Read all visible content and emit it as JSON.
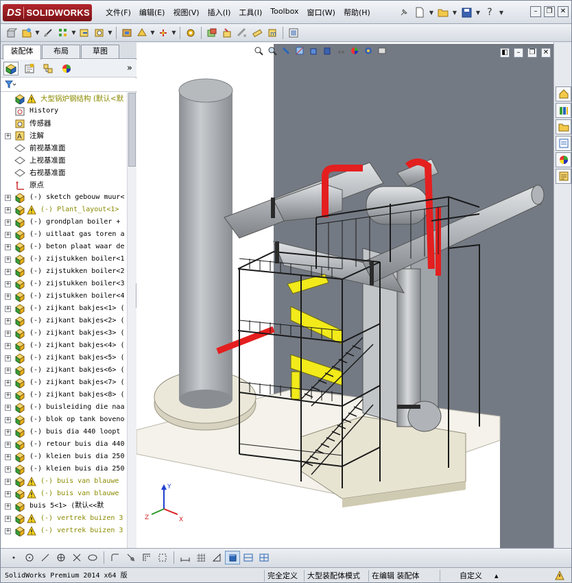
{
  "app": {
    "logo_text": "SOLIDWORKS",
    "logo_prefix": "DS",
    "menus": [
      "文件(F)",
      "编辑(E)",
      "视图(V)",
      "插入(I)",
      "工具(I)",
      "Toolbox",
      "窗口(W)",
      "帮助(H)"
    ],
    "help_glyph": "?"
  },
  "left_panel": {
    "tabs": [
      "装配体",
      "布局",
      "草图"
    ],
    "active_tab": "装配体",
    "expand_chevron": "»",
    "tree": [
      {
        "label": "大型锅炉钢结构  (默认<默",
        "icon": "assembly-root-icon",
        "warn": true,
        "expander": false,
        "mono": false,
        "warntext": true
      },
      {
        "label": "History",
        "icon": "history-icon",
        "warn": false,
        "expander": false,
        "mono": true
      },
      {
        "label": "传感器",
        "icon": "sensor-icon",
        "warn": false,
        "expander": false,
        "mono": false
      },
      {
        "label": "注解",
        "icon": "annotation-icon",
        "warn": false,
        "expander": true,
        "mono": false
      },
      {
        "label": "前视基准面",
        "icon": "plane-icon",
        "warn": false,
        "expander": false,
        "mono": false
      },
      {
        "label": "上视基准面",
        "icon": "plane-icon",
        "warn": false,
        "expander": false,
        "mono": false
      },
      {
        "label": "右视基准面",
        "icon": "plane-icon",
        "warn": false,
        "expander": false,
        "mono": false
      },
      {
        "label": "原点",
        "icon": "origin-icon",
        "warn": false,
        "expander": false,
        "mono": false
      },
      {
        "label": "(-) sketch gebouw muur<",
        "icon": "subassembly-icon",
        "warn": false,
        "expander": true,
        "mono": true
      },
      {
        "label": "(-) Plant_layout<1>",
        "icon": "subassembly-icon",
        "warn": true,
        "expander": true,
        "mono": true,
        "warntext": true
      },
      {
        "label": "(-) grondplan boiler +",
        "icon": "subassembly-icon",
        "warn": false,
        "expander": true,
        "mono": true
      },
      {
        "label": "(-) uitlaat gas toren a",
        "icon": "subassembly-icon",
        "warn": false,
        "expander": true,
        "mono": true
      },
      {
        "label": "(-) beton plaat waar de",
        "icon": "subassembly-icon",
        "warn": false,
        "expander": true,
        "mono": true
      },
      {
        "label": "(-) zijstukken boiler<1",
        "icon": "subassembly-icon",
        "warn": false,
        "expander": true,
        "mono": true
      },
      {
        "label": "(-) zijstukken boiler<2",
        "icon": "subassembly-icon",
        "warn": false,
        "expander": true,
        "mono": true
      },
      {
        "label": "(-) zijstukken boiler<3",
        "icon": "subassembly-icon",
        "warn": false,
        "expander": true,
        "mono": true
      },
      {
        "label": "(-) zijstukken boiler<4",
        "icon": "subassembly-icon",
        "warn": false,
        "expander": true,
        "mono": true
      },
      {
        "label": "(-) zijkant bakjes<1> (",
        "icon": "subassembly-icon",
        "warn": false,
        "expander": true,
        "mono": true
      },
      {
        "label": "(-) zijkant bakjes<2> (",
        "icon": "subassembly-icon",
        "warn": false,
        "expander": true,
        "mono": true
      },
      {
        "label": "(-) zijkant bakjes<3> (",
        "icon": "subassembly-icon",
        "warn": false,
        "expander": true,
        "mono": true
      },
      {
        "label": "(-) zijkant bakjes<4> (",
        "icon": "subassembly-icon",
        "warn": false,
        "expander": true,
        "mono": true
      },
      {
        "label": "(-) zijkant bakjes<5> (",
        "icon": "subassembly-icon",
        "warn": false,
        "expander": true,
        "mono": true
      },
      {
        "label": "(-) zijkant bakjes<6> (",
        "icon": "subassembly-icon",
        "warn": false,
        "expander": true,
        "mono": true
      },
      {
        "label": "(-) zijkant bakjes<7> (",
        "icon": "subassembly-icon",
        "warn": false,
        "expander": true,
        "mono": true
      },
      {
        "label": "(-) zijkant bakjes<8> (",
        "icon": "subassembly-icon",
        "warn": false,
        "expander": true,
        "mono": true
      },
      {
        "label": "(-) buisleiding die naa",
        "icon": "subassembly-icon",
        "warn": false,
        "expander": true,
        "mono": true
      },
      {
        "label": "(-) blok op tank boveno",
        "icon": "subassembly-icon",
        "warn": false,
        "expander": true,
        "mono": true
      },
      {
        "label": "(-) buis dia 440 loopt",
        "icon": "subassembly-icon",
        "warn": false,
        "expander": true,
        "mono": true
      },
      {
        "label": "(-) retour buis dia 440",
        "icon": "subassembly-icon",
        "warn": false,
        "expander": true,
        "mono": true
      },
      {
        "label": "(-) kleien buis dia 250",
        "icon": "subassembly-icon",
        "warn": false,
        "expander": true,
        "mono": true
      },
      {
        "label": "(-) kleien buis dia 250",
        "icon": "subassembly-icon",
        "warn": false,
        "expander": true,
        "mono": true
      },
      {
        "label": "(-) buis van blauwe",
        "icon": "subassembly-icon",
        "warn": true,
        "expander": true,
        "mono": true,
        "warntext": true
      },
      {
        "label": "(-) buis van blauwe",
        "icon": "subassembly-icon",
        "warn": true,
        "expander": true,
        "mono": true,
        "warntext": true
      },
      {
        "label": "buis 5<1> (默认<<默",
        "icon": "subassembly-icon",
        "warn": false,
        "expander": true,
        "mono": true
      },
      {
        "label": "(-) vertrek buizen 3",
        "icon": "subassembly-icon",
        "warn": true,
        "expander": true,
        "mono": true,
        "warntext": true
      },
      {
        "label": "(-) vertrek buizen 3",
        "icon": "subassembly-icon",
        "warn": true,
        "expander": true,
        "mono": true,
        "warntext": true
      }
    ]
  },
  "viewport": {
    "triad": {
      "x": "X",
      "y": "Y",
      "z": "Z"
    }
  },
  "status": {
    "product": "SolidWorks Premium 2014 x64 版",
    "constraint": "完全定义",
    "mode": "大型装配体模式",
    "editing": "在编辑 装配体",
    "custom": "自定义",
    "custom_arrow": "▴"
  },
  "colors": {
    "steel_gray": "#b4b8bc",
    "pipe_red": "#e41f1f",
    "duct_yellow": "#f2ea1a",
    "wall_dark": "#747a84",
    "frame_black": "#1a1a1a",
    "slab_cream": "#e8e4d2"
  }
}
